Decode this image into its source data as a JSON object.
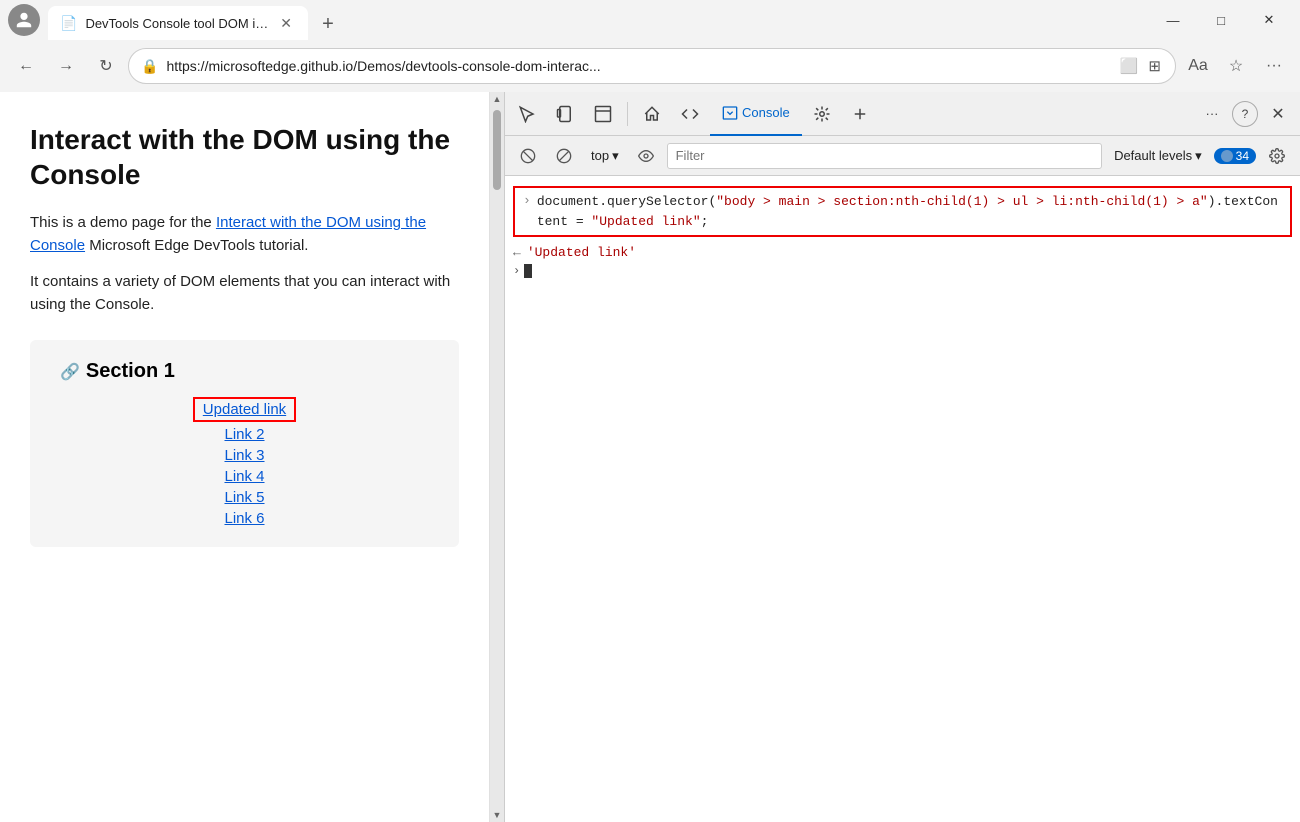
{
  "window": {
    "title": "DevTools Console tool DOM inte",
    "tab_icon": "📄"
  },
  "browser": {
    "url": "https://microsoftedge.github.io/Demos/devtools-console-dom-interac...",
    "back_disabled": false,
    "refresh_label": "⟳"
  },
  "page": {
    "title": "Interact with the DOM using the Console",
    "desc1_plain": "This is a demo page for the ",
    "desc1_link": "Interact with the DOM using the Console",
    "desc1_rest": " Microsoft Edge DevTools tutorial.",
    "desc2": "It contains a variety of DOM elements that you can interact with using the Console.",
    "section_title": "Section 1",
    "links": [
      {
        "label": "Updated link",
        "updated": true
      },
      {
        "label": "Link 2",
        "updated": false
      },
      {
        "label": "Link 3",
        "updated": false
      },
      {
        "label": "Link 4",
        "updated": false
      },
      {
        "label": "Link 5",
        "updated": false
      },
      {
        "label": "Link 6",
        "updated": false
      }
    ]
  },
  "devtools": {
    "tabs": [
      {
        "label": "Console",
        "active": true
      },
      {
        "label": "⚙️",
        "active": false
      }
    ],
    "toolbar_icons": [
      "inspect",
      "device",
      "panel",
      "home",
      "source",
      "console",
      "debug",
      "add"
    ],
    "console_bar": {
      "top_label": "top",
      "eye_icon": "👁",
      "filter_placeholder": "Filter",
      "levels_label": "Default levels",
      "issues_count": "34"
    },
    "console_input": "document.querySelector(\"body > main > section:nth-child(1) > ul > li:nth-child(1) > a\").textContent = \"Updated link\";",
    "console_output": "'Updated link'"
  },
  "labels": {
    "back": "←",
    "forward": "→",
    "refresh": "↻",
    "lock": "🔒",
    "minimize": "—",
    "maximize": "□",
    "close": "✕",
    "newtab": "+",
    "more": "···",
    "help": "?",
    "devtools_close": "✕",
    "sidebar_toggle": "☰",
    "clear": "🚫",
    "eye": "◎",
    "settings": "⚙",
    "chevron_down": "▾",
    "left_arrow_small": "←",
    "right_chevron": "›",
    "up_arrow": "▲",
    "down_arrow": "▼"
  }
}
